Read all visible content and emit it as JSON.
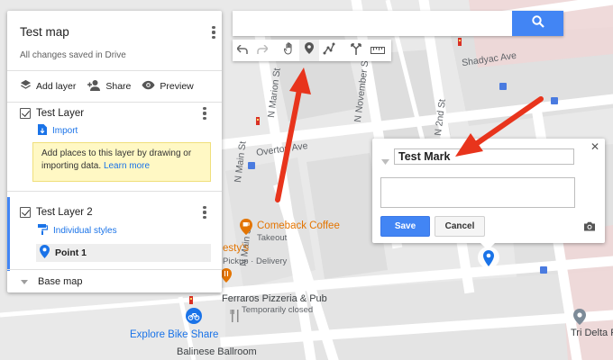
{
  "map_labels": {
    "n_marion": "N Marion St",
    "n_november": "N November St",
    "shadyac": "Shadyac Ave",
    "n_2nd": "N 2nd St",
    "overton": "Overton Ave",
    "n_main": "N Main St",
    "n_main_2": "N Main St",
    "comeback": "Comeback Coffee",
    "takeout": "Takeout",
    "testys": "esty's",
    "pickup": "Pickup · Delivery",
    "ferraros": "Ferraros Pizzeria & Pub",
    "temp_closed": "Temporarily closed",
    "explore_bike": "Explore Bike Share",
    "balinese": "Balinese Ballroom",
    "tri_delta": "Tri Delta P"
  },
  "panel": {
    "title": "Test map",
    "status": "All changes saved in Drive",
    "add_layer": "Add layer",
    "share": "Share",
    "preview": "Preview",
    "layer1": {
      "name": "Test Layer",
      "import": "Import",
      "tip": "Add places to this layer by drawing or importing data.",
      "learn_more": "Learn more"
    },
    "layer2": {
      "name": "Test Layer 2",
      "styles": "Individual styles",
      "point": "Point 1"
    },
    "base_map": "Base map"
  },
  "search": {
    "value": ""
  },
  "toolbar": {
    "tools": [
      "undo-icon",
      "redo-icon",
      "hand-icon",
      "add-marker-icon",
      "draw-line-icon",
      "directions-icon",
      "measure-icon"
    ],
    "selected_tool": "add-marker-icon"
  },
  "popup": {
    "title_value": "Test Mark",
    "description_value": "",
    "save": "Save",
    "cancel": "Cancel"
  },
  "colors": {
    "accent": "#4285f4",
    "link": "#1a73e8",
    "marker": "#1a73e8",
    "annotation_arrow": "#e8341c",
    "poi_orange": "#e37400",
    "tip_bg": "#fff8c4"
  }
}
